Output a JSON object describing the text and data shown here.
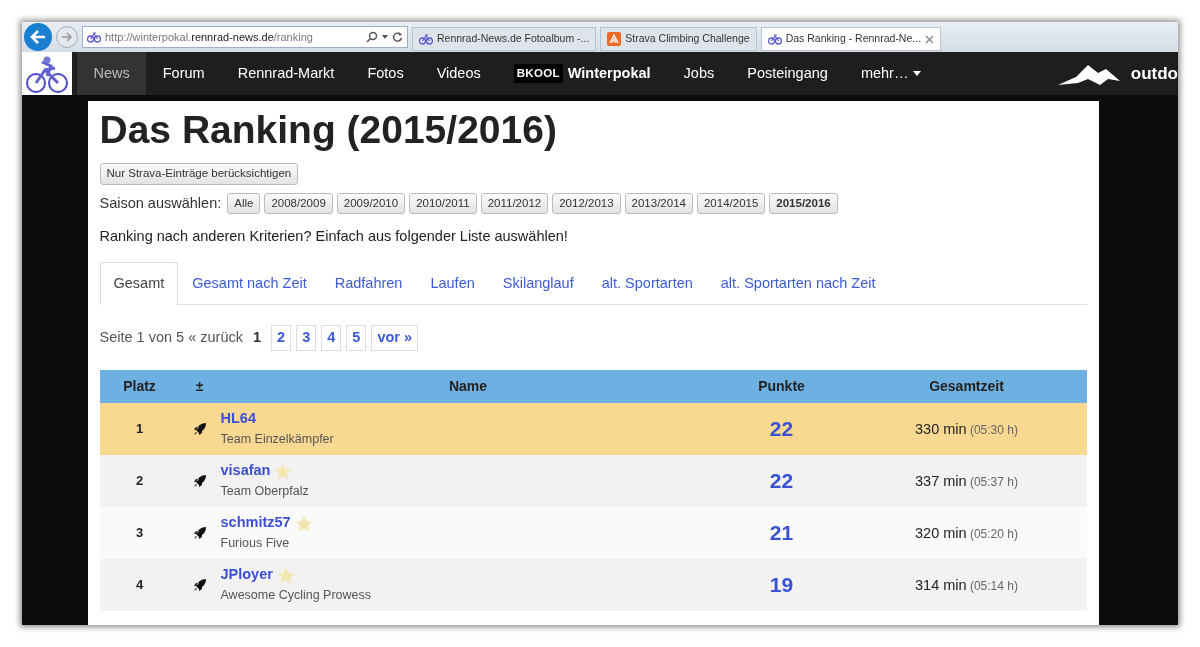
{
  "browser": {
    "address": {
      "prefix": "http://winterpokal.",
      "domain": "rennrad-news.de",
      "path": "/ranking"
    },
    "tabs": [
      {
        "label": "Rennrad-News.de Fotoalbum -...",
        "selected": false,
        "kind": "bike"
      },
      {
        "label": "Strava Climbing Challenge",
        "selected": false,
        "kind": "strava"
      },
      {
        "label": "Das Ranking - Rennrad-Ne...",
        "selected": true,
        "kind": "bike"
      }
    ]
  },
  "nav": {
    "items": [
      {
        "label": "News",
        "active": true
      },
      {
        "label": "Forum",
        "active": false
      },
      {
        "label": "Rennrad-Markt",
        "active": false
      },
      {
        "label": "Fotos",
        "active": false
      },
      {
        "label": "Videos",
        "active": false
      },
      {
        "label": "Winterpokal",
        "badge": "BKOOL",
        "active": false
      },
      {
        "label": "Jobs",
        "active": false
      },
      {
        "label": "Posteingang",
        "active": false
      },
      {
        "label": "mehr…",
        "dropdown": true,
        "active": false
      }
    ],
    "brand_right": "outdo"
  },
  "page": {
    "title": "Das Ranking (2015/2016)",
    "strava_button": "Nur Strava-Einträge berücksichtigen",
    "season_label": "Saison auswählen:",
    "seasons": [
      {
        "label": "Alle",
        "selected": false
      },
      {
        "label": "2008/2009",
        "selected": false
      },
      {
        "label": "2009/2010",
        "selected": false
      },
      {
        "label": "2010/2011",
        "selected": false
      },
      {
        "label": "2011/2012",
        "selected": false
      },
      {
        "label": "2012/2013",
        "selected": false
      },
      {
        "label": "2013/2014",
        "selected": false
      },
      {
        "label": "2014/2015",
        "selected": false
      },
      {
        "label": "2015/2016",
        "selected": true
      }
    ],
    "criteria_text": "Ranking nach anderen Kriterien? Einfach aus folgender Liste auswählen!",
    "tabs": [
      {
        "label": "Gesamt",
        "selected": true
      },
      {
        "label": "Gesamt nach Zeit",
        "selected": false
      },
      {
        "label": "Radfahren",
        "selected": false
      },
      {
        "label": "Laufen",
        "selected": false
      },
      {
        "label": "Skilanglauf",
        "selected": false
      },
      {
        "label": "alt. Sportarten",
        "selected": false
      },
      {
        "label": "alt. Sportarten nach Zeit",
        "selected": false
      }
    ],
    "pagination": {
      "info": "Seite 1 von 5",
      "prev": "« zurück",
      "pages": [
        {
          "label": "1",
          "selected": true
        },
        {
          "label": "2",
          "selected": false
        },
        {
          "label": "3",
          "selected": false
        },
        {
          "label": "4",
          "selected": false
        },
        {
          "label": "5",
          "selected": false
        }
      ],
      "next": "vor »"
    },
    "table": {
      "columns": [
        "Platz",
        "±",
        "Name",
        "Punkte",
        "Gesamtzeit"
      ],
      "rows": [
        {
          "rank": "1",
          "name": "HL64",
          "team": "Team Einzelkämpfer",
          "starred": false,
          "highlighted": true,
          "points": "22",
          "time": "330 min",
          "time_hm": "(05:30 h)"
        },
        {
          "rank": "2",
          "name": "visafan",
          "team": "Team Oberpfalz",
          "starred": true,
          "highlighted": false,
          "points": "22",
          "time": "337 min",
          "time_hm": "(05:37 h)"
        },
        {
          "rank": "3",
          "name": "schmitz57",
          "team": "Furious Five",
          "starred": true,
          "highlighted": false,
          "points": "21",
          "time": "320 min",
          "time_hm": "(05:20 h)"
        },
        {
          "rank": "4",
          "name": "JPloyer",
          "team": "Awesome Cycling Prowess",
          "starred": true,
          "highlighted": false,
          "points": "19",
          "time": "314 min",
          "time_hm": "(05:14 h)"
        }
      ]
    }
  }
}
